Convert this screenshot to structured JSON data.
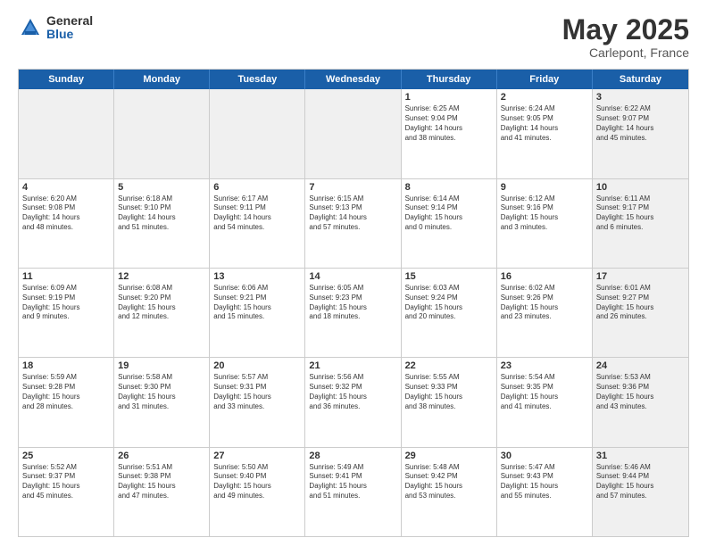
{
  "logo": {
    "general": "General",
    "blue": "Blue"
  },
  "title": "May 2025",
  "subtitle": "Carlepont, France",
  "header_days": [
    "Sunday",
    "Monday",
    "Tuesday",
    "Wednesday",
    "Thursday",
    "Friday",
    "Saturday"
  ],
  "weeks": [
    [
      {
        "day": "",
        "info": "",
        "shaded": true
      },
      {
        "day": "",
        "info": "",
        "shaded": true
      },
      {
        "day": "",
        "info": "",
        "shaded": true
      },
      {
        "day": "",
        "info": "",
        "shaded": true
      },
      {
        "day": "1",
        "info": "Sunrise: 6:25 AM\nSunset: 9:04 PM\nDaylight: 14 hours\nand 38 minutes.",
        "shaded": false
      },
      {
        "day": "2",
        "info": "Sunrise: 6:24 AM\nSunset: 9:05 PM\nDaylight: 14 hours\nand 41 minutes.",
        "shaded": false
      },
      {
        "day": "3",
        "info": "Sunrise: 6:22 AM\nSunset: 9:07 PM\nDaylight: 14 hours\nand 45 minutes.",
        "shaded": true
      }
    ],
    [
      {
        "day": "4",
        "info": "Sunrise: 6:20 AM\nSunset: 9:08 PM\nDaylight: 14 hours\nand 48 minutes.",
        "shaded": false
      },
      {
        "day": "5",
        "info": "Sunrise: 6:18 AM\nSunset: 9:10 PM\nDaylight: 14 hours\nand 51 minutes.",
        "shaded": false
      },
      {
        "day": "6",
        "info": "Sunrise: 6:17 AM\nSunset: 9:11 PM\nDaylight: 14 hours\nand 54 minutes.",
        "shaded": false
      },
      {
        "day": "7",
        "info": "Sunrise: 6:15 AM\nSunset: 9:13 PM\nDaylight: 14 hours\nand 57 minutes.",
        "shaded": false
      },
      {
        "day": "8",
        "info": "Sunrise: 6:14 AM\nSunset: 9:14 PM\nDaylight: 15 hours\nand 0 minutes.",
        "shaded": false
      },
      {
        "day": "9",
        "info": "Sunrise: 6:12 AM\nSunset: 9:16 PM\nDaylight: 15 hours\nand 3 minutes.",
        "shaded": false
      },
      {
        "day": "10",
        "info": "Sunrise: 6:11 AM\nSunset: 9:17 PM\nDaylight: 15 hours\nand 6 minutes.",
        "shaded": true
      }
    ],
    [
      {
        "day": "11",
        "info": "Sunrise: 6:09 AM\nSunset: 9:19 PM\nDaylight: 15 hours\nand 9 minutes.",
        "shaded": false
      },
      {
        "day": "12",
        "info": "Sunrise: 6:08 AM\nSunset: 9:20 PM\nDaylight: 15 hours\nand 12 minutes.",
        "shaded": false
      },
      {
        "day": "13",
        "info": "Sunrise: 6:06 AM\nSunset: 9:21 PM\nDaylight: 15 hours\nand 15 minutes.",
        "shaded": false
      },
      {
        "day": "14",
        "info": "Sunrise: 6:05 AM\nSunset: 9:23 PM\nDaylight: 15 hours\nand 18 minutes.",
        "shaded": false
      },
      {
        "day": "15",
        "info": "Sunrise: 6:03 AM\nSunset: 9:24 PM\nDaylight: 15 hours\nand 20 minutes.",
        "shaded": false
      },
      {
        "day": "16",
        "info": "Sunrise: 6:02 AM\nSunset: 9:26 PM\nDaylight: 15 hours\nand 23 minutes.",
        "shaded": false
      },
      {
        "day": "17",
        "info": "Sunrise: 6:01 AM\nSunset: 9:27 PM\nDaylight: 15 hours\nand 26 minutes.",
        "shaded": true
      }
    ],
    [
      {
        "day": "18",
        "info": "Sunrise: 5:59 AM\nSunset: 9:28 PM\nDaylight: 15 hours\nand 28 minutes.",
        "shaded": false
      },
      {
        "day": "19",
        "info": "Sunrise: 5:58 AM\nSunset: 9:30 PM\nDaylight: 15 hours\nand 31 minutes.",
        "shaded": false
      },
      {
        "day": "20",
        "info": "Sunrise: 5:57 AM\nSunset: 9:31 PM\nDaylight: 15 hours\nand 33 minutes.",
        "shaded": false
      },
      {
        "day": "21",
        "info": "Sunrise: 5:56 AM\nSunset: 9:32 PM\nDaylight: 15 hours\nand 36 minutes.",
        "shaded": false
      },
      {
        "day": "22",
        "info": "Sunrise: 5:55 AM\nSunset: 9:33 PM\nDaylight: 15 hours\nand 38 minutes.",
        "shaded": false
      },
      {
        "day": "23",
        "info": "Sunrise: 5:54 AM\nSunset: 9:35 PM\nDaylight: 15 hours\nand 41 minutes.",
        "shaded": false
      },
      {
        "day": "24",
        "info": "Sunrise: 5:53 AM\nSunset: 9:36 PM\nDaylight: 15 hours\nand 43 minutes.",
        "shaded": true
      }
    ],
    [
      {
        "day": "25",
        "info": "Sunrise: 5:52 AM\nSunset: 9:37 PM\nDaylight: 15 hours\nand 45 minutes.",
        "shaded": false
      },
      {
        "day": "26",
        "info": "Sunrise: 5:51 AM\nSunset: 9:38 PM\nDaylight: 15 hours\nand 47 minutes.",
        "shaded": false
      },
      {
        "day": "27",
        "info": "Sunrise: 5:50 AM\nSunset: 9:40 PM\nDaylight: 15 hours\nand 49 minutes.",
        "shaded": false
      },
      {
        "day": "28",
        "info": "Sunrise: 5:49 AM\nSunset: 9:41 PM\nDaylight: 15 hours\nand 51 minutes.",
        "shaded": false
      },
      {
        "day": "29",
        "info": "Sunrise: 5:48 AM\nSunset: 9:42 PM\nDaylight: 15 hours\nand 53 minutes.",
        "shaded": false
      },
      {
        "day": "30",
        "info": "Sunrise: 5:47 AM\nSunset: 9:43 PM\nDaylight: 15 hours\nand 55 minutes.",
        "shaded": false
      },
      {
        "day": "31",
        "info": "Sunrise: 5:46 AM\nSunset: 9:44 PM\nDaylight: 15 hours\nand 57 minutes.",
        "shaded": true
      }
    ]
  ]
}
